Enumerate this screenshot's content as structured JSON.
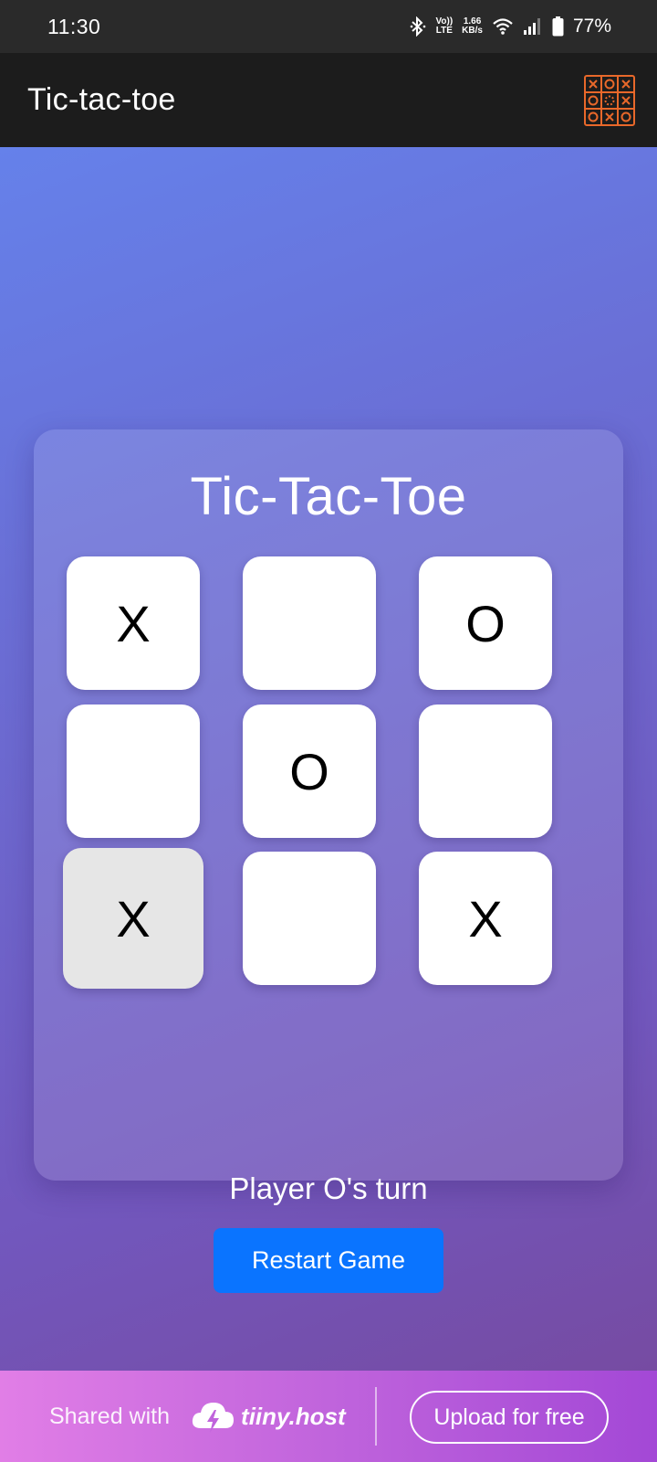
{
  "status_bar": {
    "time": "11:30",
    "volte_top": "Vo))",
    "volte_bottom": "LTE",
    "speed_top": "1.66",
    "speed_bottom": "KB/s",
    "battery": "77%"
  },
  "app_bar": {
    "title": "Tic-tac-toe",
    "logo_icon": "tic-tac-toe-grid-icon",
    "logo_color": "#e8682a"
  },
  "game": {
    "title": "Tic-Tac-Toe",
    "board": [
      "X",
      "",
      "O",
      "",
      "O",
      "",
      "X",
      "",
      "X"
    ],
    "hover_cell": 6,
    "status": "Player O's turn",
    "restart_label": "Restart Game",
    "button_color": "#0a74ff"
  },
  "footer": {
    "shared_with": "Shared with",
    "brand": "tiiny.host",
    "upload_label": "Upload for free"
  }
}
